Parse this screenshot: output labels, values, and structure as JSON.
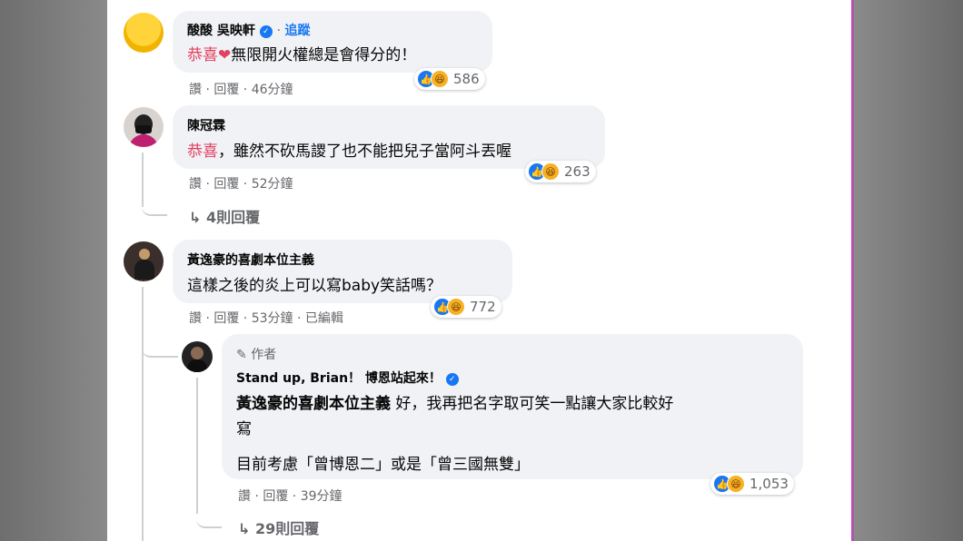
{
  "comments": [
    {
      "name": "酸酸 吳映軒",
      "follow": "追蹤",
      "highlight": "恭喜",
      "text": "無限開火權總是會得分的！",
      "meta": "讚 · 回覆 · 46分鐘",
      "reactions": "586"
    },
    {
      "name": "陳冠霖",
      "highlight": "恭喜",
      "text": "，雖然不砍馬謖了也不能把兒子當阿斗丟喔",
      "meta": "讚 · 回覆 · 52分鐘",
      "reactions": "263",
      "replies": "4則回覆"
    },
    {
      "name": "黃逸豪的喜劇本位主義",
      "text": "這樣之後的炎上可以寫baby笑話嗎？",
      "meta": "讚 · 回覆 · 53分鐘 · 已編輯",
      "reactions": "772"
    }
  ],
  "reply": {
    "author_badge": "作者",
    "name": "Stand up, Brian！ 博恩站起來！",
    "mention": "黃逸豪的喜劇本位主義",
    "text_line1": " 好，我再把名字取可笑一點讓大家比較好",
    "text_line2": "寫",
    "text_line3": "目前考慮「曾博恩二」或是「曾三國無雙」",
    "meta": "讚 · 回覆 · 39分鐘",
    "reactions": "1,053",
    "replies": "29則回覆"
  },
  "icons": {
    "like": "like-icon",
    "haha": "haha-icon",
    "reply_arrow": "reply-arrow-icon",
    "verified": "verified-icon",
    "pencil": "pencil-icon"
  },
  "colors": {
    "highlight": "#e4405f",
    "bubble": "#f0f2f5",
    "like": "#1877f2",
    "haha": "#f7b125",
    "meta": "#65676b"
  }
}
